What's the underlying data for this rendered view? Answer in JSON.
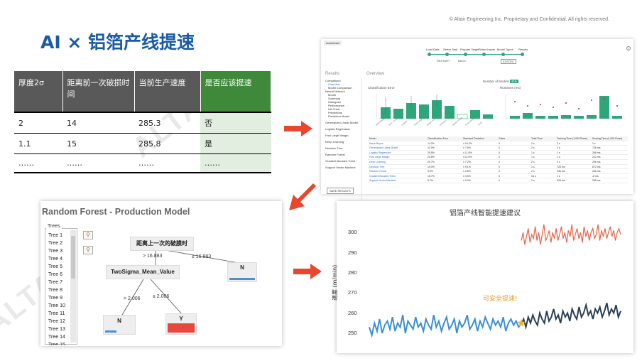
{
  "copyright": "© Altair Engineering Inc. Proprietary and Confidential. All rights reserved.",
  "slide_title": "AI × 铝箔产线提速",
  "watermark": "ALTAIR",
  "table": {
    "headers": [
      "厚度2σ",
      "距离前一次破损时间",
      "当前生产速度",
      "是否应该提速"
    ],
    "rows": [
      [
        "2",
        "14",
        "285.3",
        "否"
      ],
      [
        "1.1",
        "15",
        "285.8",
        "是"
      ],
      [
        "……",
        "……",
        "……",
        "……"
      ]
    ]
  },
  "random_forest": {
    "title": "Random Forest - Production Model",
    "trees_legend": "Trees",
    "trees": [
      "Tree 1",
      "Tree 2",
      "Tree 3",
      "Tree 4",
      "Tree 5",
      "Tree 6",
      "Tree 7",
      "Tree 8",
      "Tree 9",
      "Tree 10",
      "Tree 11",
      "Tree 12",
      "Tree 13",
      "Tree 14",
      "Tree 15"
    ],
    "root": "距离上一次的破膜时",
    "left_edge": "> 16.883",
    "right_edge": "≤ 16.883",
    "mid_node": "TwoSigma_Mean_Value",
    "mid_left_edge": "> 2.006",
    "mid_right_edge": "≤ 2.006",
    "leaf_n1": "N",
    "leaf_n2": "N",
    "leaf_y": "Y",
    "colors": {
      "n_bar": "#4a8fd8",
      "y_fill": "#e8473b"
    }
  },
  "results_shot": {
    "tab": "AutoModel",
    "steps": [
      "Load Data",
      "Select Task",
      "Prepare Target",
      "Select Inputs",
      "Model Types",
      "Results"
    ],
    "controls": [
      "RESTART",
      "BACK",
      "EXPORT"
    ],
    "left_header": "Results",
    "left_items": [
      "Comparison",
      "Overview",
      "Model Comparison",
      "Neural Network",
      "Model",
      "Summary",
      "Histogram",
      "Performance",
      "Lift Chart",
      "Predictions",
      "Prediction Model",
      "Generalized Linear Model",
      "Logistic Regression",
      "Fast Large Margin",
      "Deep Learning",
      "Decision Tree",
      "Random Forest",
      "Gradient Boosted Trees",
      "Support Vector Machine"
    ],
    "overview_header": "Overview",
    "chart1_label": "Classification Error",
    "chart2_label": "Runtimes (ms)",
    "models_label": "Number of Models",
    "models_count": "216",
    "table_cols": [
      "Model",
      "Classification Error",
      "Standard Deviation",
      "Gains",
      "Total Time",
      "Training Time (1,000 Rows)",
      "Scoring Time (1,000 Rows)"
    ],
    "table_rows": [
      [
        "Naive Bayes",
        "14.2%",
        "± 16.2%",
        "0",
        "2 s",
        "2 s",
        "1 s"
      ],
      [
        "Generalized Linear Model",
        "11.9%",
        "± 7.9%",
        "0",
        "2 s",
        "2 s",
        "736 ms"
      ],
      [
        "Logistic Regression",
        "25.5%",
        "± 11.8%",
        "0",
        "1 s",
        "1 s",
        "266 ms"
      ],
      [
        "Fast Large Margin",
        "20.8%",
        "± 11.6%",
        "0",
        "1 s",
        "1 s",
        "222 ms"
      ],
      [
        "Deep Learning",
        "29.7%",
        "± 7.2%",
        "0",
        "2 s",
        "2 s",
        "296 ms"
      ],
      [
        "Decision Tree",
        "19.0%",
        "± 9.1%",
        "0",
        "1 s",
        "726 ms",
        "872 ms"
      ],
      [
        "Random Forest",
        "5.9%",
        "± 0.6%",
        "0",
        "2 s",
        "946 ms",
        "236 ms"
      ],
      [
        "Gradient Boosted Trees",
        "10.7%",
        "± 3.0%",
        "0",
        "16 s",
        "1 s",
        "-8 ms"
      ],
      [
        "Support Vector Machine",
        "5.7%",
        "± 0.0%",
        "0",
        "1 s",
        "520 ms",
        "265 ms"
      ]
    ],
    "save_button": "SAVE RESULTS"
  },
  "speed_chart": {
    "title": "铝箔产线智能提速建议",
    "ylabel": "速度 (m/min)",
    "annotation": "可安全提速!",
    "colors": {
      "early": "#3a8fd6",
      "late": "#2c3f55",
      "target": "#e8624a",
      "marker": "#f0b429",
      "annotation": "#e8982b"
    },
    "chart_data": {
      "type": "line",
      "ylim": [
        245,
        305
      ],
      "yticks": [
        250,
        260,
        270,
        280,
        290,
        300
      ],
      "series": [
        {
          "values": [
            253,
            249,
            255,
            251,
            257,
            250,
            254,
            256,
            252,
            258,
            251,
            255,
            253,
            259,
            250,
            256,
            254,
            252,
            258,
            253,
            255,
            251,
            257,
            254,
            252,
            259,
            253,
            256,
            251,
            255,
            258,
            252,
            254,
            257,
            250,
            256,
            253,
            255,
            259,
            252,
            254,
            257,
            251,
            256,
            253,
            258,
            255,
            252,
            257,
            254,
            256,
            253,
            258,
            251,
            255,
            257,
            254,
            256,
            253,
            255
          ]
        },
        {
          "values": [
            254,
            257,
            253,
            258,
            255,
            259,
            256,
            254,
            260,
            257,
            255,
            261,
            256,
            258,
            262,
            257,
            259,
            255,
            261,
            258,
            260,
            256,
            262,
            259,
            257,
            263,
            258,
            260,
            264,
            259,
            261,
            257,
            262,
            260,
            263,
            258,
            261,
            265,
            259,
            262,
            260,
            264,
            258,
            261
          ]
        },
        {
          "values": [
            296,
            300,
            294,
            298,
            302,
            295,
            299,
            297,
            303,
            296,
            300,
            294,
            299,
            304,
            296,
            298,
            301,
            295,
            300,
            297,
            302,
            296,
            299,
            303,
            297,
            300,
            295,
            301,
            298,
            304,
            296,
            299,
            302,
            297,
            300,
            295,
            303,
            298,
            301,
            296,
            300,
            302,
            297,
            299,
            304,
            296,
            301,
            298,
            302,
            297,
            300,
            303,
            298,
            301,
            296,
            300,
            302,
            299
          ]
        }
      ],
      "marker_value": 255
    }
  }
}
